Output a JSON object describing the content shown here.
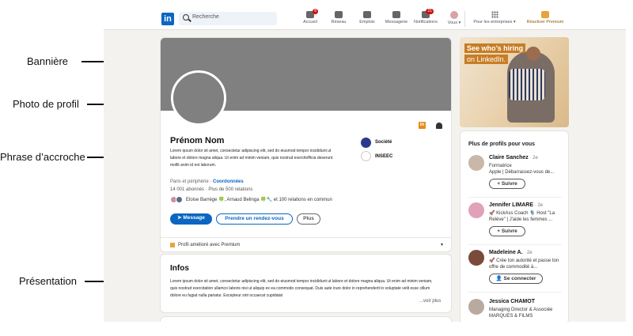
{
  "annotations": {
    "banniere": "Bannière",
    "photo": "Photo de profil",
    "phrase": "Phrase d’accroche",
    "presentation": "Présentation"
  },
  "nav": {
    "logo": "in",
    "search_placeholder": "Recherche",
    "items": [
      {
        "label": "Accueil",
        "badge": "8",
        "icon": "home-icon"
      },
      {
        "label": "Réseau",
        "badge": "",
        "icon": "network-icon"
      },
      {
        "label": "Emplois",
        "badge": "",
        "icon": "briefcase-icon"
      },
      {
        "label": "Messagerie",
        "badge": "",
        "icon": "message-icon"
      },
      {
        "label": "Notifications",
        "badge": "21",
        "icon": "bell-icon"
      },
      {
        "label": "Vous ▾",
        "badge": "",
        "icon": "avatar-icon"
      }
    ],
    "business": "Pour les entreprises ▾",
    "premium": "Réactiver Premium"
  },
  "profile": {
    "name": "Prénom Nom",
    "bio": "Lorem ipsum dolor sit amet, consectetur adipiscing elit, sed do eiusmod tempor incididunt ut labore et dolore magna aliqua. Ut enim ad minim veniam, quis nostrud exercitation ullamco laboris nisi ut aliquip ex ea commodo.",
    "bio_short": "Lorem ipsum dolor sit amet, consectetur adipiscing elit, sed do eiusmod tempor incididunt ut labore et dolore magna aliqua. Ut enim ad minim veniam, quis nostrud exercitofficia deserunt mollit anim id est laborum.",
    "location": "Paris et périphérie · ",
    "contact_link": "Coordonnées",
    "followers": "14 001 abonnés · Plus de 500 relations",
    "mutual": "Eloise Barrège 🍀, Arnaud Belinga 🍀🔧 et 100 relations en commun",
    "company": "Société",
    "school": "INSEEC",
    "buttons": {
      "message": "➤ Message",
      "meeting": "Prendre un rendez-vous",
      "more": "Plus"
    },
    "premium_bar": "Profil amélioré avec Premium",
    "premium_chevron": "▾"
  },
  "infos": {
    "title": "Infos",
    "text": "Lorem ipsum dolor sit amet, consectetur adipiscing elit, sed do eiusmod tempor incididunt ut labore et dolore magna aliqua. Ut enim ad minim veniam, quis nostrud exercitation ullamco laboris nisi ut aliquip ex ea commodo consequat. Duis aute irure dolor in reprehenderit in voluptate velit esse cillum dolore eu fugiat nulla pariatur. Excepteur sint occaecat cupidatat",
    "more": "...voir plus"
  },
  "ad": {
    "line1": "See who’s hiring",
    "line2": "on LinkedIn."
  },
  "people": {
    "header": "Plus de profils pour vous",
    "list": [
      {
        "name": "Claire Sanchez",
        "degree": " · 2e",
        "headline": "Formatrice\nApple | Débarrassez-vous de...",
        "button": "+ Suivre",
        "color": "#c9b8a8"
      },
      {
        "name": "Jennifer LIMARE",
        "degree": " · 2e",
        "headline": "🚀 KickAss Coach 🎙️ Host \"La Relève\" | J'aide les femmes ...",
        "button": "+ Suivre",
        "color": "#e0a1b9"
      },
      {
        "name": "Madeleine A.",
        "degree": " · 2e",
        "headline": "🚀 Crée ton autorité et passe ton offre de commodité à...",
        "button": "👤 Se connecter",
        "color": "#7a4a3a"
      },
      {
        "name": "Jessica CHAMOT",
        "degree": "",
        "headline": "Managing Director & Associée\nMARQUES & FILMS",
        "button": "",
        "color": "#b9aaa0"
      }
    ]
  }
}
